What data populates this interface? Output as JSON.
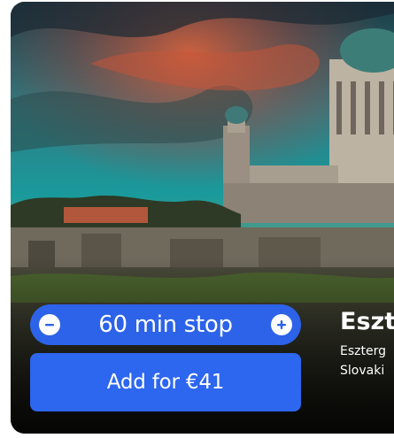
{
  "card": {
    "image_alt": "Esztergom Basilica at sunset",
    "title": "Eszte",
    "subtitle_line1": "Eszterg",
    "subtitle_line2": "Slovaki"
  },
  "stop_stepper": {
    "label": "60 min stop",
    "decrease_icon": "minus-circle-icon",
    "increase_icon": "plus-circle-icon"
  },
  "add_button": {
    "label": "Add for €41"
  },
  "colors": {
    "accent": "#2c63e8",
    "text": "#ffffff"
  }
}
